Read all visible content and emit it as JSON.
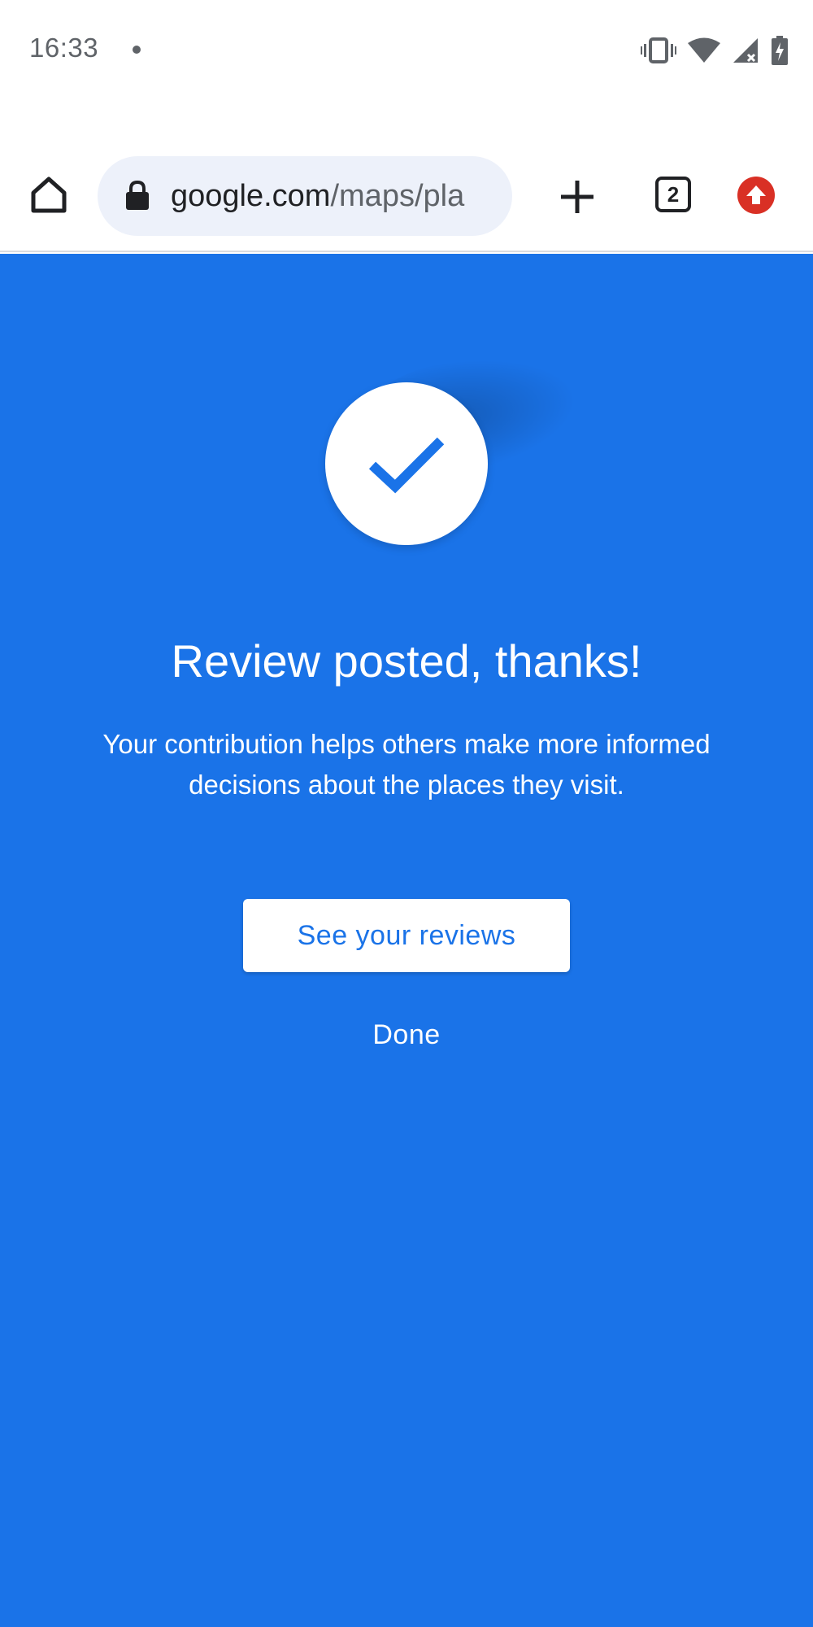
{
  "status_bar": {
    "time": "16:33",
    "icons": [
      "notification-dot-icon",
      "vibrate-icon",
      "wifi-icon",
      "cell-signal-no-service-icon",
      "battery-charging-icon"
    ]
  },
  "browser": {
    "url_host": "google.com",
    "url_path": "/maps/pla",
    "tab_count": "2",
    "icons": [
      "home-icon",
      "lock-icon",
      "new-tab-icon",
      "tab-switcher-icon",
      "update-icon"
    ]
  },
  "confirmation": {
    "icon": "checkmark-icon",
    "title": "Review posted, thanks!",
    "description": "Your contribution helps others make more informed decisions about the places they visit.",
    "primary_button": "See your reviews",
    "secondary_button": "Done"
  },
  "colors": {
    "background": "#1a73e8",
    "button_text": "#1a73e8",
    "update_badge": "#d93025"
  }
}
